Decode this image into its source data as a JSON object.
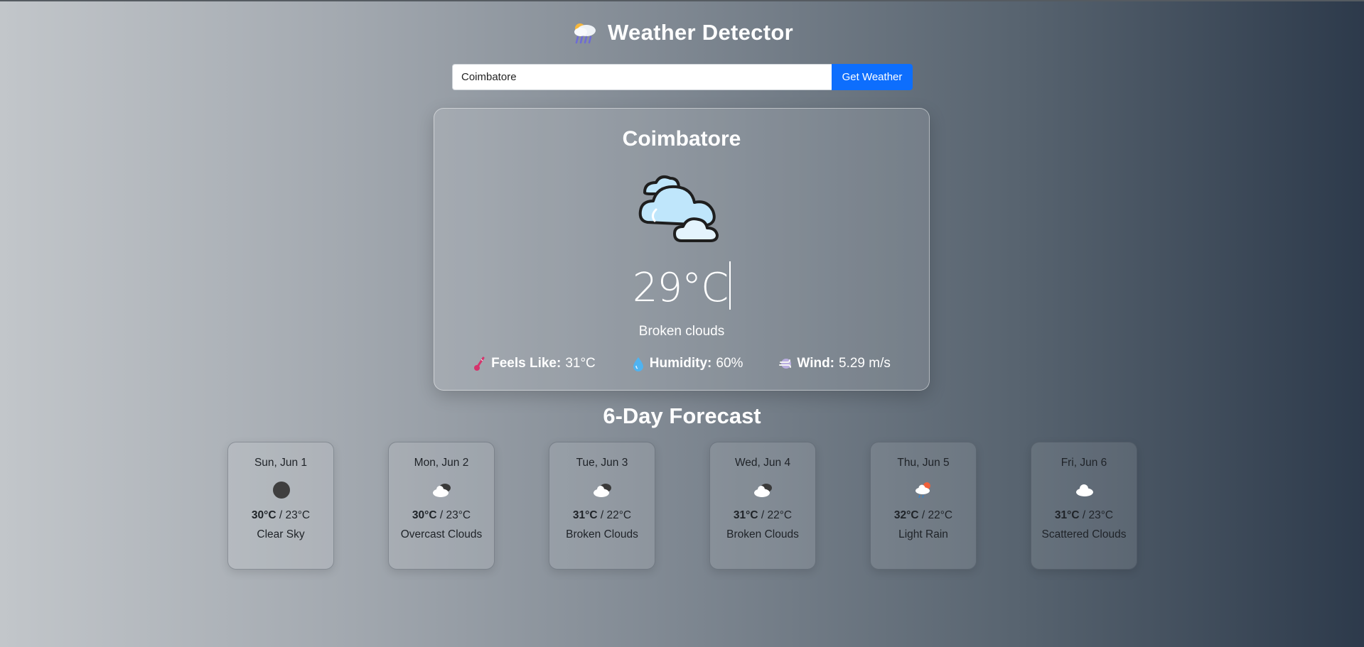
{
  "header": {
    "title": "Weather Detector",
    "icon": "cloud-rain-icon"
  },
  "search": {
    "value": "Coimbatore",
    "button_label": "Get Weather"
  },
  "current": {
    "city": "Coimbatore",
    "icon": "broken-clouds-icon",
    "temperature": "29°C",
    "description": "Broken clouds",
    "feels_like": {
      "label": "Feels Like:",
      "value": "31°C",
      "icon": "thermometer-icon"
    },
    "humidity": {
      "label": "Humidity:",
      "value": "60%",
      "icon": "droplet-icon"
    },
    "wind": {
      "label": "Wind:",
      "value": "5.29 m/s",
      "icon": "wind-icon"
    }
  },
  "forecast": {
    "title": "6-Day Forecast",
    "days": [
      {
        "date": "Sun, Jun 1",
        "high": "30°C",
        "low": "23°C",
        "desc": "Clear Sky",
        "icon": "clear-sky-icon"
      },
      {
        "date": "Mon, Jun 2",
        "high": "30°C",
        "low": "23°C",
        "desc": "Overcast Clouds",
        "icon": "overcast-clouds-icon"
      },
      {
        "date": "Tue, Jun 3",
        "high": "31°C",
        "low": "22°C",
        "desc": "Broken Clouds",
        "icon": "broken-clouds-icon"
      },
      {
        "date": "Wed, Jun 4",
        "high": "31°C",
        "low": "22°C",
        "desc": "Broken Clouds",
        "icon": "broken-clouds-icon"
      },
      {
        "date": "Thu, Jun 5",
        "high": "32°C",
        "low": "22°C",
        "desc": "Light Rain",
        "icon": "light-rain-icon"
      },
      {
        "date": "Fri, Jun 6",
        "high": "31°C",
        "low": "23°C",
        "desc": "Scattered Clouds",
        "icon": "scattered-clouds-icon"
      }
    ]
  },
  "colors": {
    "accent": "#0d6efd",
    "text": "#ffffff",
    "card_text": "#1f2328"
  }
}
